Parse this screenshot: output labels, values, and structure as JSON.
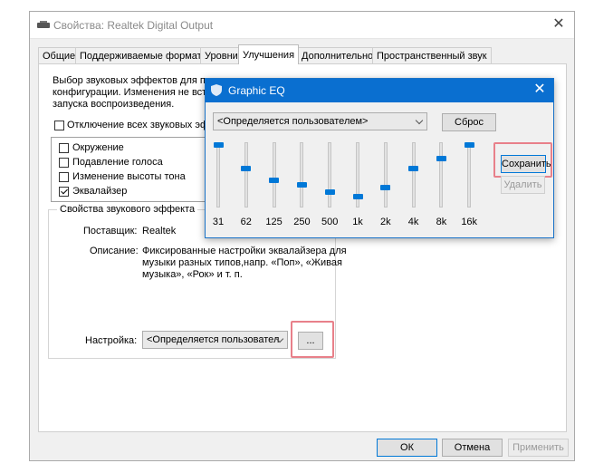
{
  "window": {
    "title": "Свойства: Realtek Digital Output",
    "close_glyph": "✕"
  },
  "tabs": [
    {
      "label": "Общие"
    },
    {
      "label": "Поддерживаемые форматы"
    },
    {
      "label": "Уровни"
    },
    {
      "label": "Улучшения"
    },
    {
      "label": "Дополнительно"
    },
    {
      "label": "Пространственный звук"
    }
  ],
  "active_tab": "Улучшения",
  "enhancements": {
    "description_lines": [
      "Выбор звуковых эффектов для при",
      "конфигурации. Изменения не вступ",
      "запуска воспроизведения."
    ],
    "disable_all_label": "Отключение всех звуковых эфф",
    "disable_all_checked": false,
    "effects": [
      {
        "label": "Окружение",
        "checked": false
      },
      {
        "label": "Подавление голоса",
        "checked": false
      },
      {
        "label": "Изменение высоты тона",
        "checked": false
      },
      {
        "label": "Эквалайзер",
        "checked": true
      }
    ],
    "group_title": "Свойства звукового эффекта",
    "provider_label": "Поставщик:",
    "provider_value": "Realtek",
    "description_label": "Описание:",
    "description_value_lines": [
      "Фиксированные настройки эквалайзера для",
      "музыки разных типов,напр. «Поп», «Живая",
      "музыка», «Рок» и т. п."
    ],
    "setting_label": "Настройка:",
    "setting_value": "<Определяется пользовател",
    "more_button": "..."
  },
  "footer": {
    "ok": "ОК",
    "cancel": "Отмена",
    "apply": "Применить"
  },
  "eq": {
    "title": "Graphic EQ",
    "close_glyph": "✕",
    "preset": "<Определяется пользователем>",
    "reset": "Сброс",
    "save": "Сохранить",
    "delete": "Удалить",
    "bands": [
      {
        "freq": "31",
        "level": 0.0
      },
      {
        "freq": "62",
        "level": 0.41
      },
      {
        "freq": "125",
        "level": 0.61
      },
      {
        "freq": "250",
        "level": 0.69
      },
      {
        "freq": "500",
        "level": 0.81
      },
      {
        "freq": "1k",
        "level": 0.89
      },
      {
        "freq": "2k",
        "level": 0.73
      },
      {
        "freq": "4k",
        "level": 0.41
      },
      {
        "freq": "8k",
        "level": 0.23
      },
      {
        "freq": "16k",
        "level": 0.0
      }
    ]
  },
  "colors": {
    "accent": "#0078d7",
    "eq_titlebar": "#0a6fd0",
    "highlight": "#e8808a"
  }
}
